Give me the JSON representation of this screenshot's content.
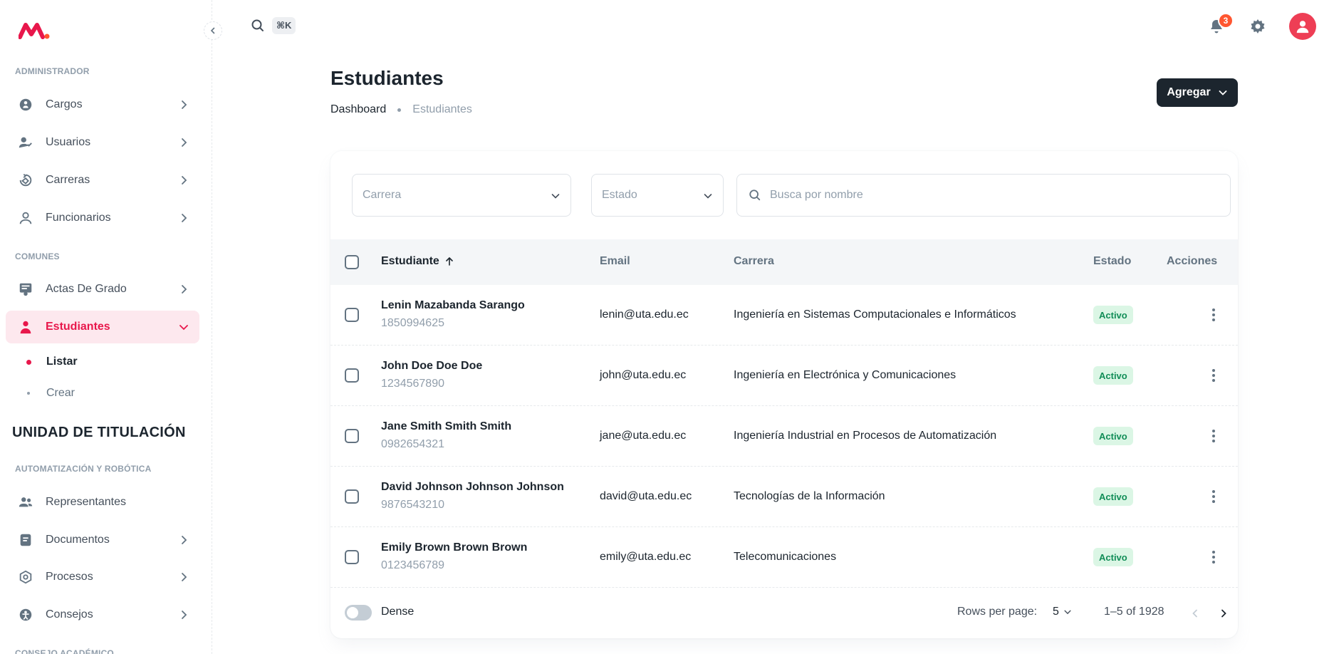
{
  "sidebar": {
    "section_admin": "ADMINISTRADOR",
    "section_comunes": "COMUNES",
    "unit_title": "UNIDAD DE TITULACIÓN",
    "section_auto": "AUTOMATIZACIÓN Y ROBÓTICA",
    "section_consejo": "CONSEJO ACADÉMICO",
    "admin_items": [
      {
        "label": "Cargos",
        "icon": "badge-icon"
      },
      {
        "label": "Usuarios",
        "icon": "user-check-icon"
      },
      {
        "label": "Carreras",
        "icon": "refresh-icon"
      },
      {
        "label": "Funcionarios",
        "icon": "person-icon"
      }
    ],
    "comunes_items": [
      {
        "label": "Actas De Grado",
        "icon": "certificate-icon"
      },
      {
        "label": "Estudiantes",
        "icon": "student-icon",
        "active": true
      }
    ],
    "sub_items": [
      {
        "label": "Listar",
        "active": true
      },
      {
        "label": "Crear"
      }
    ],
    "auto_items": [
      {
        "label": "Representantes",
        "icon": "users-icon"
      },
      {
        "label": "Documentos",
        "icon": "document-icon"
      },
      {
        "label": "Procesos",
        "icon": "process-icon"
      },
      {
        "label": "Consejos",
        "icon": "council-icon"
      }
    ]
  },
  "topbar": {
    "shortcut": "⌘K",
    "notifications_count": "3",
    "brand_color": "#e8174b"
  },
  "page": {
    "title": "Estudiantes",
    "breadcrumb": [
      "Dashboard",
      "Estudiantes"
    ],
    "add_button": "Agregar"
  },
  "filters": {
    "carrera_placeholder": "Carrera",
    "estado_placeholder": "Estado",
    "search_placeholder": "Busca por nombre"
  },
  "table": {
    "headers": [
      "Estudiante",
      "Email",
      "Carrera",
      "Estado",
      "Acciones"
    ],
    "rows": [
      {
        "name": "Lenin Mazabanda Sarango",
        "id": "1850994625",
        "email": "lenin@uta.edu.ec",
        "career": "Ingeniería en Sistemas Computacionales e Informáticos",
        "status": "Activo"
      },
      {
        "name": "John Doe Doe Doe",
        "id": "1234567890",
        "email": "john@uta.edu.ec",
        "career": "Ingeniería en Electrónica y Comunicaciones",
        "status": "Activo"
      },
      {
        "name": "Jane Smith Smith Smith",
        "id": "0982654321",
        "email": "jane@uta.edu.ec",
        "career": "Ingeniería Industrial en Procesos de Automatización",
        "status": "Activo"
      },
      {
        "name": "David Johnson Johnson Johnson",
        "id": "9876543210",
        "email": "david@uta.edu.ec",
        "career": "Tecnologías de la Información",
        "status": "Activo"
      },
      {
        "name": "Emily Brown Brown Brown",
        "id": "0123456789",
        "email": "emily@uta.edu.ec",
        "career": "Telecomunicaciones",
        "status": "Activo"
      }
    ]
  },
  "footer": {
    "dense_label": "Dense",
    "rows_per_page_label": "Rows per page:",
    "rows_per_page_value": "5",
    "range": "1–5 of 1928"
  }
}
